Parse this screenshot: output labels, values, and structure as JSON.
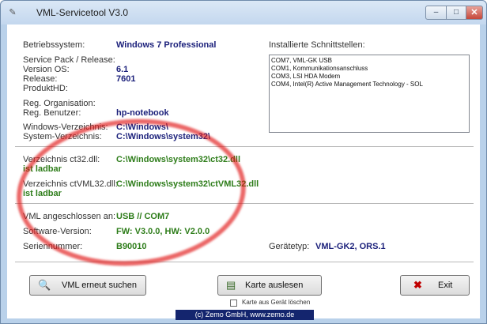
{
  "window": {
    "title": "VML-Servicetool V3.0",
    "app_icon": "tool-icon",
    "minimize_glyph": "–",
    "maximize_glyph": "□",
    "close_glyph": "✕"
  },
  "system": {
    "os_label": "Betriebssystem:",
    "os_value": "Windows 7 Professional",
    "sp_label": "Service Pack / Release:",
    "version_label": "Version OS:",
    "version_value": "6.1",
    "release_label": "Release:",
    "release_value": "7601",
    "productid_label": "ProduktHD:",
    "org_label": "Reg. Organisation:",
    "user_label": "Reg. Benutzer:",
    "user_value": "hp-notebook",
    "windir_label": "Windows-Verzeichnis:",
    "windir_value": "C:\\Windows\\",
    "sysdir_label": "System-Verzeichnis:",
    "sysdir_value": "C:\\Windows\\system32\\"
  },
  "dll": {
    "ct32_label": "Verzeichnis ct32.dll:",
    "ct32_value": "C:\\Windows\\system32\\ct32.dll",
    "ct32_status": "ist ladbar",
    "ctvml_label": "Verzeichnis ctVML32.dll:",
    "ctvml_value": "C:\\Windows\\system32\\ctVML32.dll",
    "ctvml_status": "ist ladbar"
  },
  "device": {
    "connected_label": "VML angeschlossen an:",
    "connected_value": "USB  //  COM7",
    "software_label": "Software-Version:",
    "software_value": "FW: V3.0.0, HW: V2.0.0",
    "serial_label": "Seriennummer:",
    "serial_value": "B90010",
    "type_label": "Gerätetyp:",
    "type_value": "VML-GK2, ORS.1"
  },
  "interfaces": {
    "heading": "Installierte Schnittstellen:",
    "items": [
      "COM7, VML-GK USB",
      "COM1, Kommunikationsanschluss",
      "COM3, LSI HDA Modem",
      "COM4, Intel(R) Active Management Technology - SOL"
    ]
  },
  "buttons": {
    "search_label": "VML erneut suchen",
    "read_label": "Karte auslesen",
    "exit_label": "Exit"
  },
  "checkbox": {
    "label": "Karte aus Gerät löschen",
    "checked": false
  },
  "footer": {
    "text": "(c) Zemo GmbH, www.zemo.de"
  },
  "colors": {
    "value_blue": "#1a1f7a",
    "value_green": "#2e7d1a",
    "footer_bg": "#14256e",
    "annotation_red": "#e11414"
  }
}
